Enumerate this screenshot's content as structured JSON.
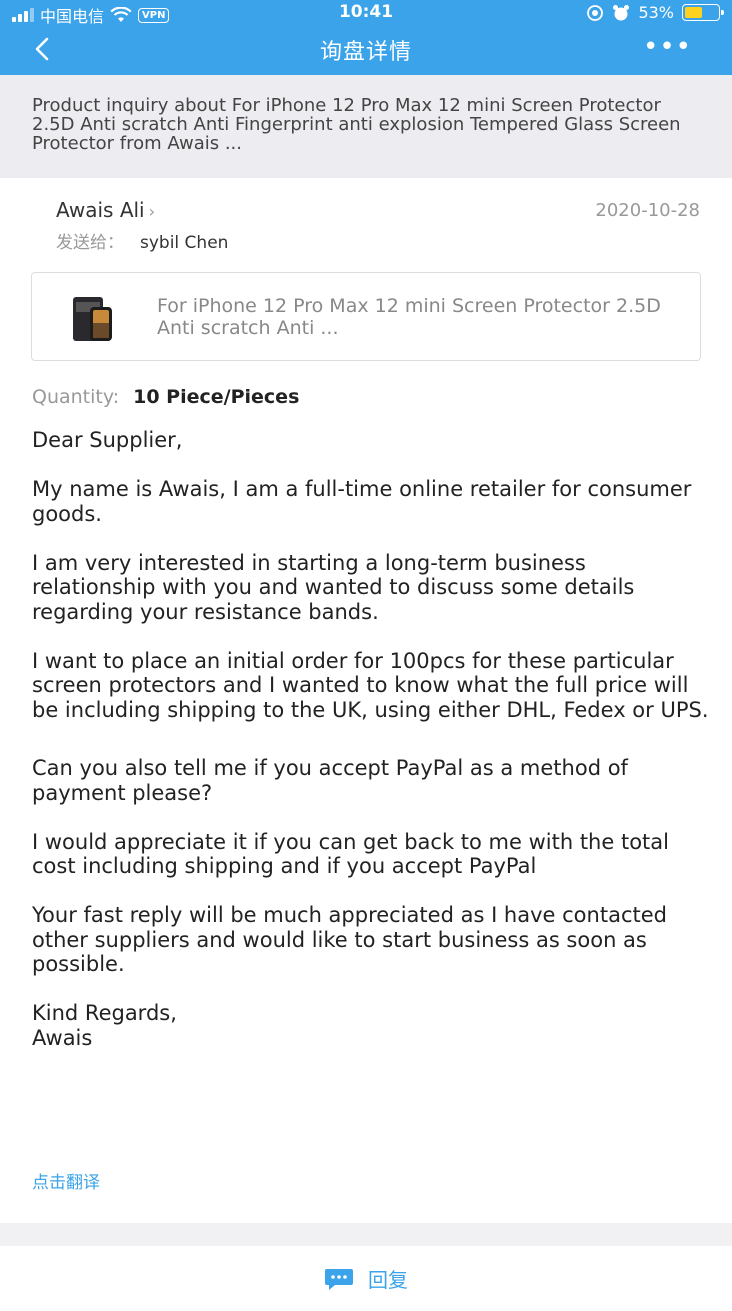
{
  "status_bar": {
    "carrier": "中国电信",
    "vpn": "VPN",
    "time": "10:41",
    "battery": "53%",
    "battery_level": 0.53
  },
  "nav": {
    "title": "询盘详情"
  },
  "subject": "Product inquiry about For iPhone 12 Pro Max 12 mini Screen Protector 2.5D Anti scratch Anti Fingerprint anti explosion Tempered Glass Screen Protector from Awais ...",
  "sender": {
    "name": "Awais Ali",
    "date": "2020-10-28",
    "send_to_label": "发送给：",
    "send_to": "sybil Chen"
  },
  "product": {
    "title": "For iPhone 12 Pro Max 12 mini Screen Protector 2.5D Anti scratch Anti ..."
  },
  "quantity": {
    "label": "Quantity:",
    "value": "10 Piece/Pieces"
  },
  "message": {
    "greeting": "Dear Supplier,",
    "p1": "My name is Awais, I am a full-time online retailer for consumer goods.",
    "p2": "I am very interested in starting a long-term business relationship with you and wanted to discuss some details regarding your resistance bands.",
    "p3": "I want to place an initial order for 100pcs for these particular screen protectors and I wanted to know what the full price will be including shipping to the UK, using either DHL, Fedex or UPS.",
    "p4": "Can you also tell me if you accept PayPal as a method of payment please?",
    "p5": "I would appreciate it if you can get back to me with the total cost including shipping and if you accept PayPal",
    "p6": "Your fast reply will be much appreciated as I have contacted other suppliers and would like to start business as soon as possible.",
    "closing": "Kind Regards,",
    "signature": "Awais"
  },
  "translate_label": "点击翻译",
  "reply_label": "回复",
  "colors": {
    "accent": "#3ba3ea",
    "battery": "#ffd21f"
  }
}
